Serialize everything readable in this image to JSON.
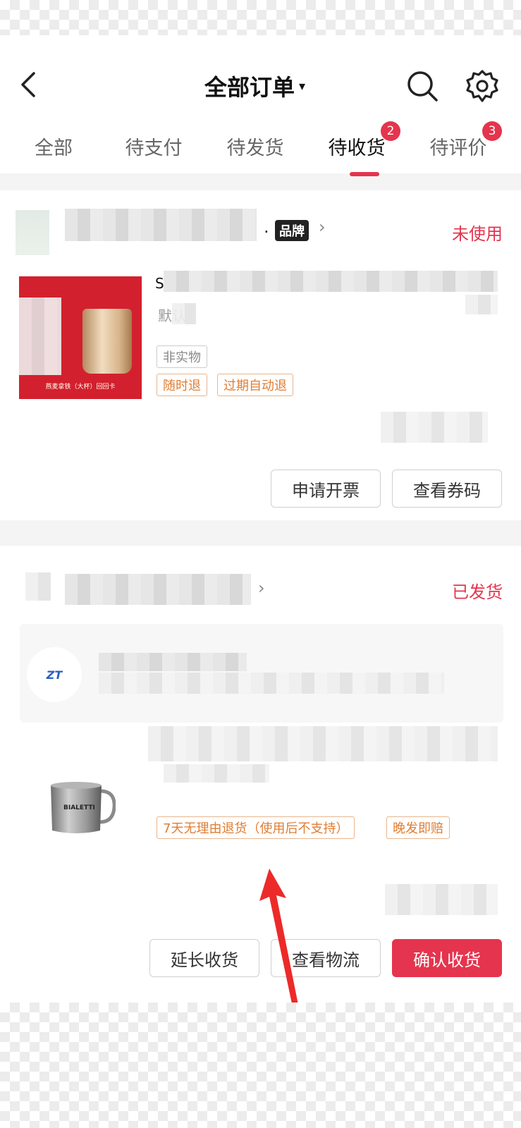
{
  "header": {
    "title": "全部订单",
    "caret": "▾"
  },
  "tabs": [
    {
      "label": "全部",
      "active": false
    },
    {
      "label": "待支付",
      "active": false
    },
    {
      "label": "待发货",
      "active": false
    },
    {
      "label": "待收货",
      "active": true,
      "badge": "2"
    },
    {
      "label": "待评价",
      "active": false,
      "badge": "3"
    }
  ],
  "order1": {
    "shop_dot": ".",
    "brand_tag": "品牌",
    "status": "未使用",
    "product_title_start": "S",
    "spec": "默认",
    "tags": [
      "非实物",
      "随时退",
      "过期自动退"
    ],
    "image_caption": "燕麦拿铁（大杯）回回卡",
    "buttons": [
      "申请开票",
      "查看券码"
    ]
  },
  "order2": {
    "status": "已发货",
    "logistics_logo": "ZT",
    "tags": [
      "7天无理由退货（使用后不支持）",
      "晚发即赔"
    ],
    "mug_brand": "BIALETTI",
    "buttons": [
      "延长收货",
      "查看物流",
      "确认收货"
    ]
  },
  "colors": {
    "accent": "#e5344d",
    "tag_orange": "#e07d33"
  }
}
